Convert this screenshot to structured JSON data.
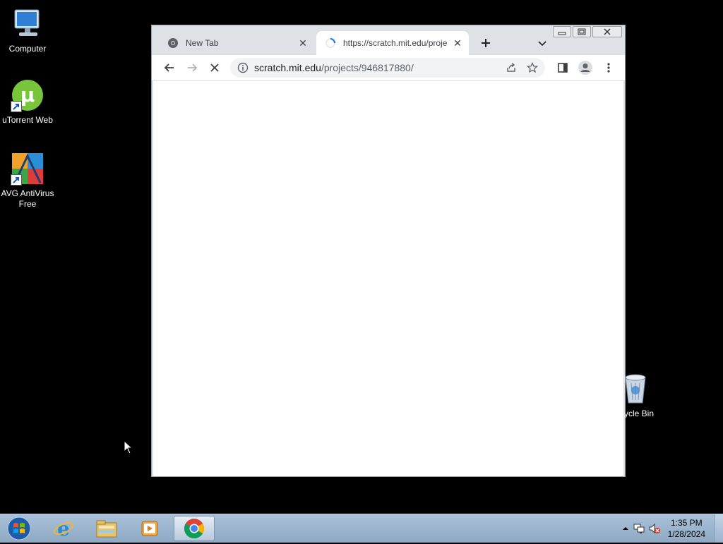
{
  "desktop": {
    "icons": [
      {
        "label": "Computer",
        "icon": "computer-icon"
      },
      {
        "label": "uTorrent Web",
        "icon": "utorrent-icon"
      },
      {
        "label": "AVG AntiVirus Free",
        "icon": "avg-icon"
      },
      {
        "label": "ycle Bin",
        "icon": "recycle-bin-icon"
      }
    ]
  },
  "browser": {
    "tabs": [
      {
        "title": "New Tab",
        "state": "inactive"
      },
      {
        "title": "https://scratch.mit.edu/proje",
        "state": "active-loading"
      }
    ],
    "omnibox": {
      "host": "scratch.mit.edu",
      "path": "/projects/946817880/"
    },
    "colors": {
      "frame": "#dee1e6",
      "toolbar": "#ffffff",
      "omnibox": "#f1f3f4"
    }
  },
  "taskbar": {
    "apps": [
      "internet-explorer-icon",
      "file-explorer-icon",
      "media-player-icon",
      "chrome-icon"
    ],
    "clock": {
      "time": "1:35 PM",
      "date": "1/28/2024"
    }
  }
}
